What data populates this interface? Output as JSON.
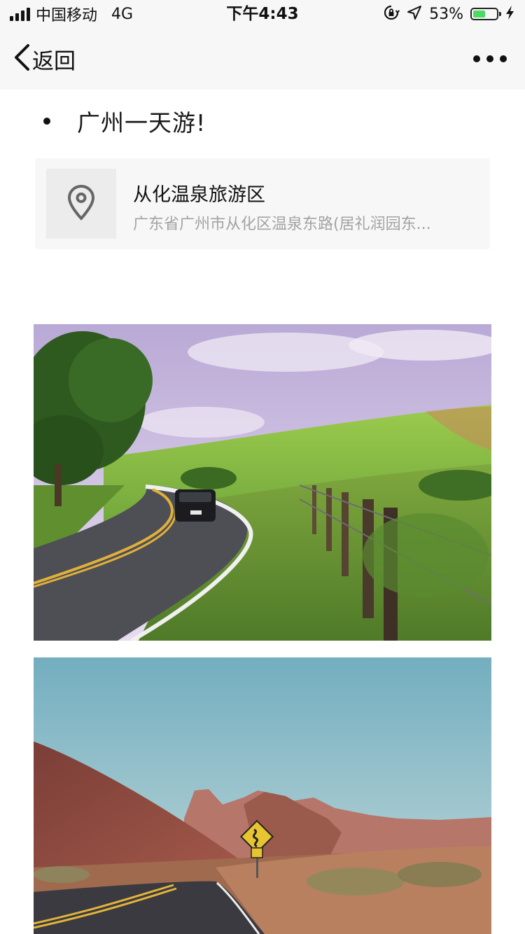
{
  "status_bar": {
    "carrier": "中国移动",
    "network": "4G",
    "time": "下午4:43",
    "battery_percent": "53%",
    "battery_level": 0.53,
    "icons": [
      "signal-icon",
      "orientation-lock-icon",
      "location-arrow-icon",
      "battery-icon",
      "charging-bolt-icon"
    ]
  },
  "nav": {
    "back_label": "返回",
    "more_icon": "more-dots-icon"
  },
  "content": {
    "title": "广州一天游!",
    "location": {
      "name": "从化温泉旅游区",
      "address": "广东省广州市从化区温泉东路(居礼润园东...",
      "icon": "map-pin-icon"
    },
    "photos": [
      {
        "subject": "winding road through green hills"
      },
      {
        "subject": "desert road with red rocks and road sign"
      }
    ]
  },
  "colors": {
    "bar_background": "#f7f7f7",
    "card_background": "#f7f7f7",
    "secondary_text": "#a3a3a3",
    "battery_green": "#4cd964"
  }
}
